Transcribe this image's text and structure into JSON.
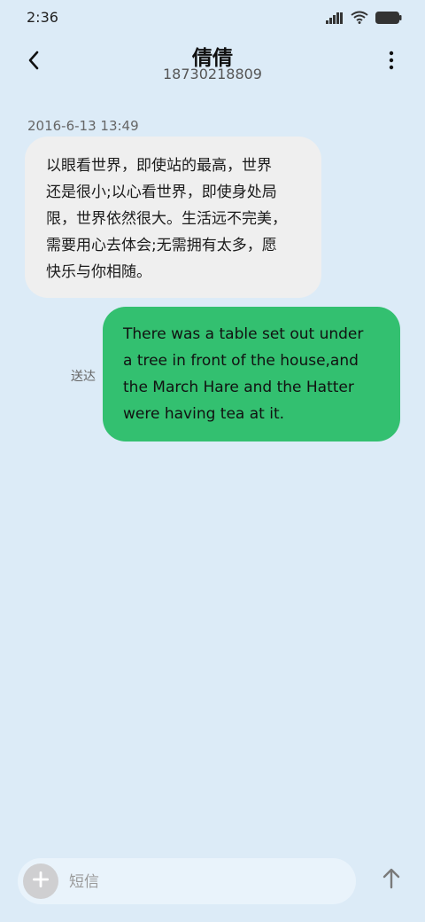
{
  "status_bar": {
    "time": "2:36",
    "icons": [
      "signal-icon",
      "wifi-icon",
      "battery-icon"
    ]
  },
  "header": {
    "contact_name": "倩倩",
    "contact_number": "18730218809",
    "back_icon": "chevron-left-icon",
    "more_icon": "more-vertical-icon"
  },
  "conversation": {
    "timestamp": "2016-6-13 13:49",
    "incoming_message": {
      "lines": [
        "以眼看世界，即使站的最高，世界",
        "还是很小;以心看世界，即使身处局",
        "限，世界依然很大。生活远不完美，",
        "需要用心去体会;无需拥有太多，愿",
        "快乐与你相随。"
      ]
    },
    "outgoing_message": {
      "lines": [
        "There was a table set out under",
        "a tree in front of the house,and",
        "the March Hare and the Hatter",
        "were having tea at it."
      ],
      "status": "送达"
    }
  },
  "composer": {
    "placeholder": "短信",
    "value": "",
    "add_icon": "plus-icon",
    "send_icon": "arrow-up-icon"
  },
  "colors": {
    "background": "#dcebf7",
    "incoming_bubble": "#efefef",
    "outgoing_bubble": "#33c070"
  }
}
